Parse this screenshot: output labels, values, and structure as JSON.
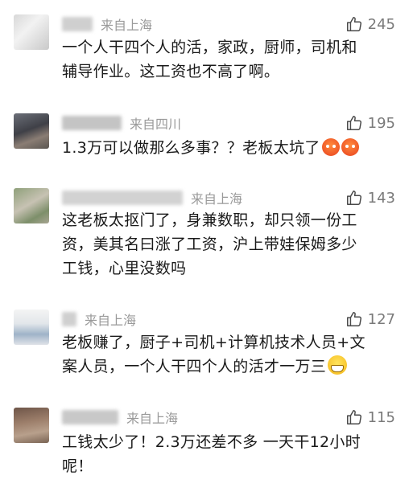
{
  "comments": [
    {
      "location": "来自上海",
      "likes": "245",
      "text_lines": [
        "一个人干四个人的活，家政，厨师，司机和",
        "辅导作业。这工资也不高了啊。"
      ],
      "emoji": ""
    },
    {
      "location": "来自四川",
      "likes": "195",
      "text_lines": [
        "1.3万可以做那么多事？？老板太坑了"
      ],
      "emoji": "angry"
    },
    {
      "location": "来自上海",
      "likes": "143",
      "text_lines": [
        "这老板太抠门了，身兼数职，却只领一份工",
        "资，美其名曰涨了工资，沪上带娃保姆多少",
        "工钱，心里没数吗"
      ],
      "emoji": ""
    },
    {
      "location": "来自上海",
      "likes": "127",
      "text_lines": [
        "老板赚了，厨子+司机+计算机技术人员+文",
        "案人员，一个人干四个人的活才一万三"
      ],
      "emoji": "grin"
    },
    {
      "location": "来自上海",
      "likes": "115",
      "text_lines": [
        "工钱太少了！2.3万还差不多 一天干12小时",
        "呢！"
      ],
      "emoji": ""
    }
  ],
  "icons": {
    "like": "thumbs-up-icon"
  },
  "colors": {
    "location_text": "#9a9a9a",
    "like_icon": "#4a4a4a"
  }
}
